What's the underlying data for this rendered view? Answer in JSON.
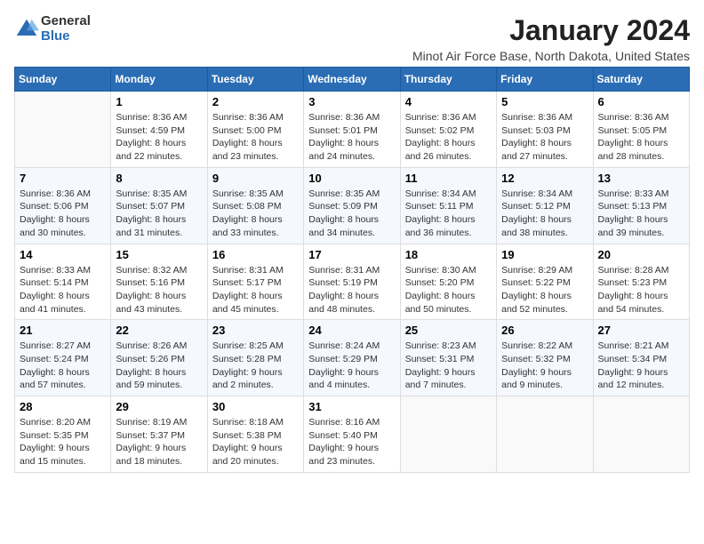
{
  "logo": {
    "general": "General",
    "blue": "Blue"
  },
  "title": "January 2024",
  "subtitle": "Minot Air Force Base, North Dakota, United States",
  "weekdays": [
    "Sunday",
    "Monday",
    "Tuesday",
    "Wednesday",
    "Thursday",
    "Friday",
    "Saturday"
  ],
  "weeks": [
    [
      {
        "day": "",
        "info": ""
      },
      {
        "day": "1",
        "info": "Sunrise: 8:36 AM\nSunset: 4:59 PM\nDaylight: 8 hours\nand 22 minutes."
      },
      {
        "day": "2",
        "info": "Sunrise: 8:36 AM\nSunset: 5:00 PM\nDaylight: 8 hours\nand 23 minutes."
      },
      {
        "day": "3",
        "info": "Sunrise: 8:36 AM\nSunset: 5:01 PM\nDaylight: 8 hours\nand 24 minutes."
      },
      {
        "day": "4",
        "info": "Sunrise: 8:36 AM\nSunset: 5:02 PM\nDaylight: 8 hours\nand 26 minutes."
      },
      {
        "day": "5",
        "info": "Sunrise: 8:36 AM\nSunset: 5:03 PM\nDaylight: 8 hours\nand 27 minutes."
      },
      {
        "day": "6",
        "info": "Sunrise: 8:36 AM\nSunset: 5:05 PM\nDaylight: 8 hours\nand 28 minutes."
      }
    ],
    [
      {
        "day": "7",
        "info": "Sunrise: 8:36 AM\nSunset: 5:06 PM\nDaylight: 8 hours\nand 30 minutes."
      },
      {
        "day": "8",
        "info": "Sunrise: 8:35 AM\nSunset: 5:07 PM\nDaylight: 8 hours\nand 31 minutes."
      },
      {
        "day": "9",
        "info": "Sunrise: 8:35 AM\nSunset: 5:08 PM\nDaylight: 8 hours\nand 33 minutes."
      },
      {
        "day": "10",
        "info": "Sunrise: 8:35 AM\nSunset: 5:09 PM\nDaylight: 8 hours\nand 34 minutes."
      },
      {
        "day": "11",
        "info": "Sunrise: 8:34 AM\nSunset: 5:11 PM\nDaylight: 8 hours\nand 36 minutes."
      },
      {
        "day": "12",
        "info": "Sunrise: 8:34 AM\nSunset: 5:12 PM\nDaylight: 8 hours\nand 38 minutes."
      },
      {
        "day": "13",
        "info": "Sunrise: 8:33 AM\nSunset: 5:13 PM\nDaylight: 8 hours\nand 39 minutes."
      }
    ],
    [
      {
        "day": "14",
        "info": "Sunrise: 8:33 AM\nSunset: 5:14 PM\nDaylight: 8 hours\nand 41 minutes."
      },
      {
        "day": "15",
        "info": "Sunrise: 8:32 AM\nSunset: 5:16 PM\nDaylight: 8 hours\nand 43 minutes."
      },
      {
        "day": "16",
        "info": "Sunrise: 8:31 AM\nSunset: 5:17 PM\nDaylight: 8 hours\nand 45 minutes."
      },
      {
        "day": "17",
        "info": "Sunrise: 8:31 AM\nSunset: 5:19 PM\nDaylight: 8 hours\nand 48 minutes."
      },
      {
        "day": "18",
        "info": "Sunrise: 8:30 AM\nSunset: 5:20 PM\nDaylight: 8 hours\nand 50 minutes."
      },
      {
        "day": "19",
        "info": "Sunrise: 8:29 AM\nSunset: 5:22 PM\nDaylight: 8 hours\nand 52 minutes."
      },
      {
        "day": "20",
        "info": "Sunrise: 8:28 AM\nSunset: 5:23 PM\nDaylight: 8 hours\nand 54 minutes."
      }
    ],
    [
      {
        "day": "21",
        "info": "Sunrise: 8:27 AM\nSunset: 5:24 PM\nDaylight: 8 hours\nand 57 minutes."
      },
      {
        "day": "22",
        "info": "Sunrise: 8:26 AM\nSunset: 5:26 PM\nDaylight: 8 hours\nand 59 minutes."
      },
      {
        "day": "23",
        "info": "Sunrise: 8:25 AM\nSunset: 5:28 PM\nDaylight: 9 hours\nand 2 minutes."
      },
      {
        "day": "24",
        "info": "Sunrise: 8:24 AM\nSunset: 5:29 PM\nDaylight: 9 hours\nand 4 minutes."
      },
      {
        "day": "25",
        "info": "Sunrise: 8:23 AM\nSunset: 5:31 PM\nDaylight: 9 hours\nand 7 minutes."
      },
      {
        "day": "26",
        "info": "Sunrise: 8:22 AM\nSunset: 5:32 PM\nDaylight: 9 hours\nand 9 minutes."
      },
      {
        "day": "27",
        "info": "Sunrise: 8:21 AM\nSunset: 5:34 PM\nDaylight: 9 hours\nand 12 minutes."
      }
    ],
    [
      {
        "day": "28",
        "info": "Sunrise: 8:20 AM\nSunset: 5:35 PM\nDaylight: 9 hours\nand 15 minutes."
      },
      {
        "day": "29",
        "info": "Sunrise: 8:19 AM\nSunset: 5:37 PM\nDaylight: 9 hours\nand 18 minutes."
      },
      {
        "day": "30",
        "info": "Sunrise: 8:18 AM\nSunset: 5:38 PM\nDaylight: 9 hours\nand 20 minutes."
      },
      {
        "day": "31",
        "info": "Sunrise: 8:16 AM\nSunset: 5:40 PM\nDaylight: 9 hours\nand 23 minutes."
      },
      {
        "day": "",
        "info": ""
      },
      {
        "day": "",
        "info": ""
      },
      {
        "day": "",
        "info": ""
      }
    ]
  ]
}
